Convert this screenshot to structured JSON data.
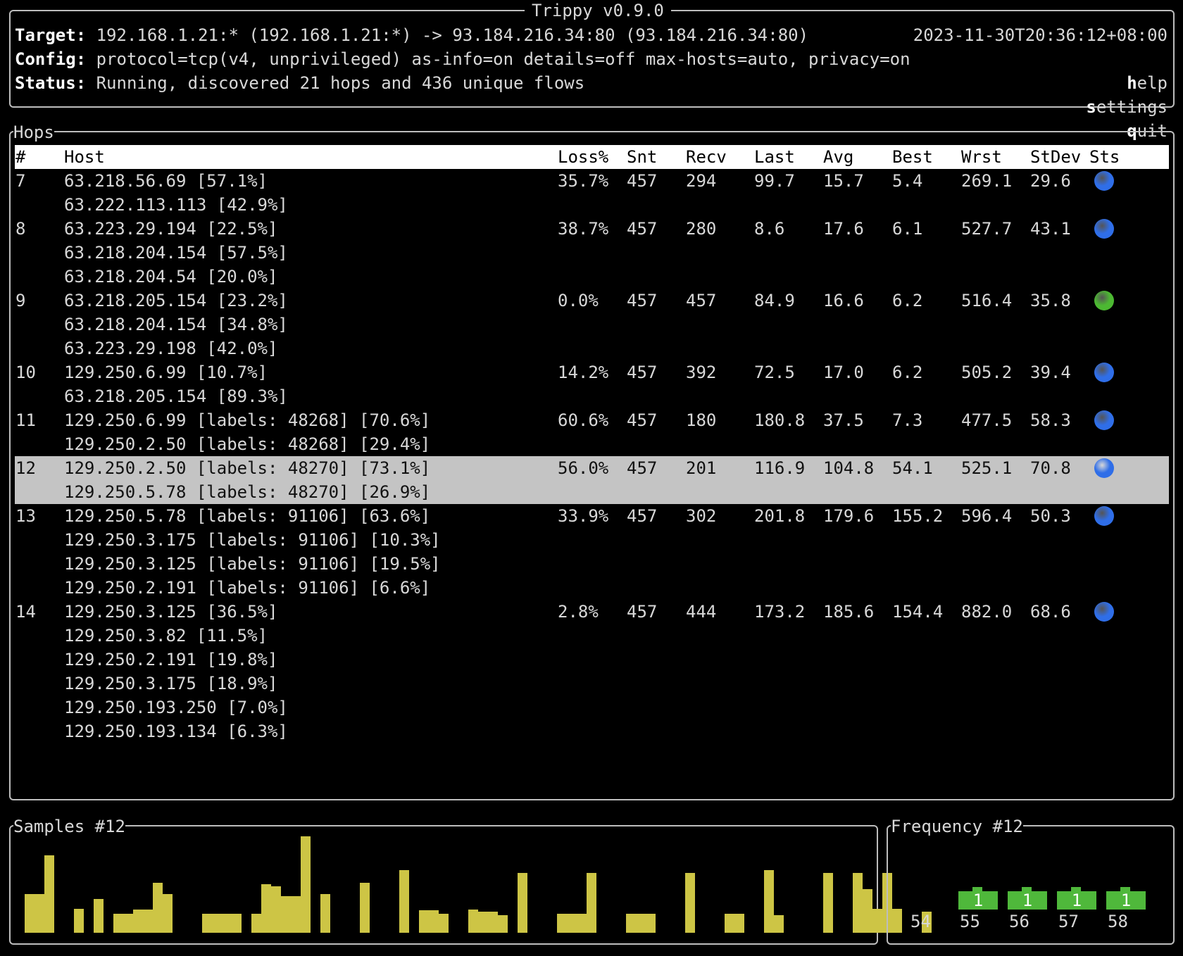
{
  "header": {
    "title": "Trippy v0.9.0",
    "target_label": "Target:",
    "target_value": "192.168.1.21:* (192.168.1.21:*) -> 93.184.216.34:80 (93.184.216.34:80)",
    "config_label": "Config:",
    "config_value": "protocol=tcp(v4, unprivileged) as-info=on details=off max-hosts=auto, privacy=on",
    "status_label": "Status:",
    "status_value": "Running, discovered 21 hops and 436 unique flows",
    "timestamp": "2023-11-30T20:36:12+08:00",
    "menu": [
      {
        "hot": "h",
        "rest": "elp"
      },
      {
        "hot": "s",
        "rest": "ettings"
      },
      {
        "hot": "q",
        "rest": "uit"
      }
    ]
  },
  "hops_panel": {
    "title": "Hops",
    "columns": [
      "#",
      "Host",
      "Loss%",
      "Snt",
      "Recv",
      "Last",
      "Avg",
      "Best",
      "Wrst",
      "StDev",
      "Sts"
    ],
    "rows": [
      {
        "hop": "7",
        "hosts": [
          "63.218.56.69 [57.1%]",
          "63.222.113.113 [42.9%]"
        ],
        "loss": "35.7%",
        "snt": "457",
        "recv": "294",
        "last": "99.7",
        "avg": "15.7",
        "best": "5.4",
        "wrst": "269.1",
        "stdev": "29.6",
        "status": "blue",
        "selected": false
      },
      {
        "hop": "8",
        "hosts": [
          "63.223.29.194 [22.5%]",
          "63.218.204.154 [57.5%]",
          "63.218.204.54 [20.0%]"
        ],
        "loss": "38.7%",
        "snt": "457",
        "recv": "280",
        "last": "8.6",
        "avg": "17.6",
        "best": "6.1",
        "wrst": "527.7",
        "stdev": "43.1",
        "status": "blue",
        "selected": false
      },
      {
        "hop": "9",
        "hosts": [
          "63.218.205.154 [23.2%]",
          "63.218.204.154 [34.8%]",
          "63.223.29.198 [42.0%]"
        ],
        "loss": "0.0%",
        "snt": "457",
        "recv": "457",
        "last": "84.9",
        "avg": "16.6",
        "best": "6.2",
        "wrst": "516.4",
        "stdev": "35.8",
        "status": "green",
        "selected": false
      },
      {
        "hop": "10",
        "hosts": [
          "129.250.6.99 [10.7%]",
          "63.218.205.154 [89.3%]"
        ],
        "loss": "14.2%",
        "snt": "457",
        "recv": "392",
        "last": "72.5",
        "avg": "17.0",
        "best": "6.2",
        "wrst": "505.2",
        "stdev": "39.4",
        "status": "blue",
        "selected": false
      },
      {
        "hop": "11",
        "hosts": [
          "129.250.6.99 [labels: 48268] [70.6%]",
          "129.250.2.50 [labels: 48268] [29.4%]"
        ],
        "loss": "60.6%",
        "snt": "457",
        "recv": "180",
        "last": "180.8",
        "avg": "37.5",
        "best": "7.3",
        "wrst": "477.5",
        "stdev": "58.3",
        "status": "blue",
        "selected": false
      },
      {
        "hop": "12",
        "hosts": [
          "129.250.2.50 [labels: 48270] [73.1%]",
          "129.250.5.78 [labels: 48270] [26.9%]"
        ],
        "loss": "56.0%",
        "snt": "457",
        "recv": "201",
        "last": "116.9",
        "avg": "104.8",
        "best": "54.1",
        "wrst": "525.1",
        "stdev": "70.8",
        "status": "blue",
        "selected": true
      },
      {
        "hop": "13",
        "hosts": [
          "129.250.5.78 [labels: 91106] [63.6%]",
          "129.250.3.175 [labels: 91106] [10.3%]",
          "129.250.3.125 [labels: 91106] [19.5%]",
          "129.250.2.191 [labels: 91106] [6.6%]"
        ],
        "loss": "33.9%",
        "snt": "457",
        "recv": "302",
        "last": "201.8",
        "avg": "179.6",
        "best": "155.2",
        "wrst": "596.4",
        "stdev": "50.3",
        "status": "blue",
        "selected": false
      },
      {
        "hop": "14",
        "hosts": [
          "129.250.3.125 [36.5%]",
          "129.250.3.82 [11.5%]",
          "129.250.2.191 [19.8%]",
          "129.250.3.175 [18.9%]",
          "129.250.193.250 [7.0%]",
          "129.250.193.134 [6.3%]"
        ],
        "loss": "2.8%",
        "snt": "457",
        "recv": "444",
        "last": "173.2",
        "avg": "185.6",
        "best": "154.4",
        "wrst": "882.0",
        "stdev": "68.6",
        "status": "blue",
        "selected": false
      }
    ]
  },
  "samples_panel": {
    "title": "Samples #12",
    "bar_color": "#cdc545",
    "values": [
      4,
      4,
      8,
      0,
      0,
      2.5,
      0,
      3.5,
      0,
      2,
      2,
      2.4,
      2.4,
      5.2,
      4,
      0,
      0,
      0,
      2,
      2,
      2,
      2,
      0,
      2,
      5,
      4.8,
      3.8,
      3.8,
      10,
      0,
      4,
      0,
      0,
      0,
      5.2,
      0,
      0,
      0,
      6.5,
      0,
      2.3,
      2.3,
      2,
      0,
      0,
      2.4,
      2.2,
      2.2,
      1.8,
      0,
      6.2,
      0,
      0,
      0,
      2,
      2,
      2,
      6.2,
      0,
      0,
      0,
      2,
      2,
      2,
      0,
      0,
      0,
      6.2,
      0,
      0,
      0,
      2,
      2,
      0,
      0,
      6.5,
      1.8,
      0,
      0,
      0,
      0,
      6.2,
      0,
      0,
      6.2,
      4.5,
      2.5,
      6.2,
      2.5,
      0,
      0,
      2.2
    ]
  },
  "frequency_panel": {
    "title": "Frequency #12",
    "bar_color": "#4fb83b",
    "labels": [
      "54",
      "55",
      "56",
      "57",
      "58"
    ],
    "counts": [
      0,
      1,
      1,
      1,
      1
    ]
  },
  "colors": {
    "status_blue": "#2f6ee8",
    "status_green": "#4cb832",
    "selected_row": "#c4c4c4"
  }
}
